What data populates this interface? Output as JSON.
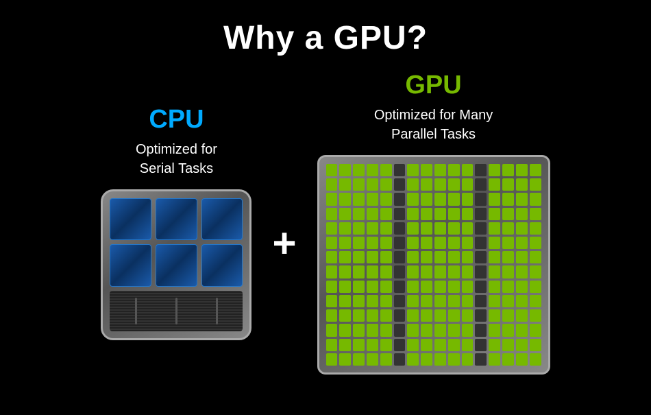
{
  "title": "Why a GPU?",
  "cpu": {
    "label": "CPU",
    "description_line1": "Optimized for",
    "description_line2": "Serial Tasks",
    "cores_cols": 3,
    "cores_rows": 2
  },
  "plus": "+",
  "gpu": {
    "label": "GPU",
    "description_line1": "Optimized for Many",
    "description_line2": "Parallel Tasks",
    "cols": 16,
    "rows": 14
  },
  "colors": {
    "cpu_label": "#00aaff",
    "gpu_label": "#76b900",
    "background": "#000000",
    "text": "#ffffff"
  }
}
